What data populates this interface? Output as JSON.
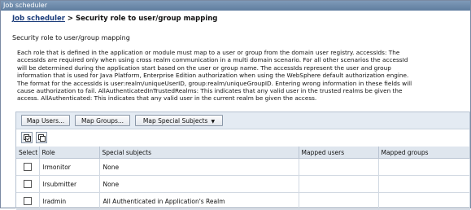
{
  "window": {
    "title": "Job scheduler"
  },
  "breadcrumb": {
    "link": "Job scheduler",
    "separator": " > ",
    "current": "Security role to user/group mapping"
  },
  "page": {
    "subtitle": "Security role to user/group mapping",
    "description_lines": [
      "Each role that is defined in the application or module must map to a user or group from the domain user registry. accessIds: The",
      "accessIds are required only when using cross realm communication in a multi domain scenario. For all other scenarios the accessId",
      "will be determined during the application start based on the user or group name. The accessIds represent the user and group",
      "information that is used for Java Platform, Enterprise Edition authorization when using the WebSphere default authorization engine.",
      "The format for the accessIds is user:realm/uniqueUserID, group:realm/uniqueGroupID. Entering wrong information in these fields will",
      "cause authorization to fail. AllAuthenticatedInTrustedRealms: This indicates that any valid user in the trusted realms be given the",
      "access. AllAuthenticated: This indicates that any valid user in the current realm be given the access."
    ]
  },
  "toolbar": {
    "map_users": "Map Users...",
    "map_groups": "Map Groups...",
    "map_special": "Map Special Subjects",
    "select_all_icon": "select-all-icon",
    "deselect_all_icon": "deselect-all-icon"
  },
  "table": {
    "headers": {
      "select": "Select",
      "role": "Role",
      "special": "Special subjects",
      "users": "Mapped users",
      "groups": "Mapped groups"
    },
    "rows": [
      {
        "role": "lrmonitor",
        "special": "None",
        "users": "",
        "groups": ""
      },
      {
        "role": "lrsubmitter",
        "special": "None",
        "users": "",
        "groups": ""
      },
      {
        "role": "lradmin",
        "special": "All Authenticated in Application's Realm",
        "users": "",
        "groups": ""
      }
    ]
  },
  "colors": {
    "titlebar": "#6b88aa",
    "link": "#1b3c7a",
    "header_bg": "#dfe6ee",
    "toolbar_bg": "#e4ebf3"
  }
}
